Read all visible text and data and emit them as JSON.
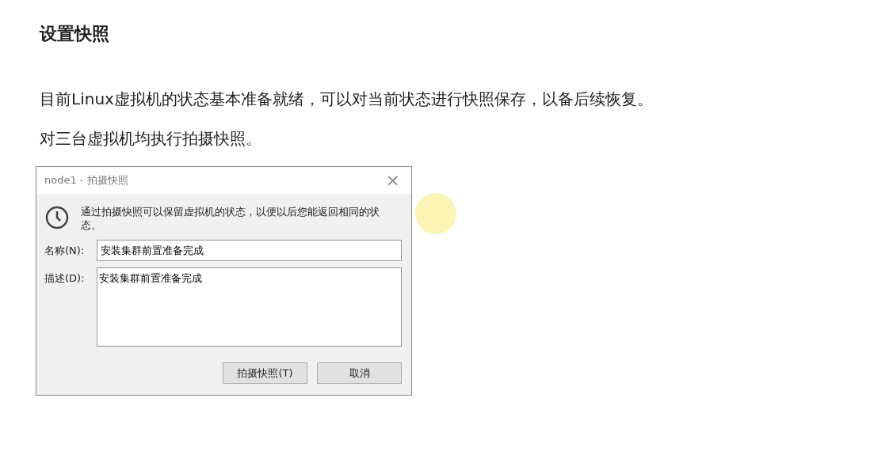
{
  "heading": "设置快照",
  "paragraphs": [
    "目前Linux虚拟机的状态基本准备就绪，可以对当前状态进行快照保存，以备后续恢复。",
    "对三台虚拟机均执行拍摄快照。"
  ],
  "dialog": {
    "title": "node1 - 拍摄快照",
    "close": "×",
    "message": "通过拍摄快照可以保留虚拟机的状态，以便以后您能返回相同的状态。",
    "name_label": "名称(N):",
    "name_value": "安装集群前置准备完成",
    "description_label": "描述(D):",
    "description_value": "安装集群前置准备完成",
    "buttons": [
      "拍摄快照(T)",
      "取消"
    ]
  }
}
